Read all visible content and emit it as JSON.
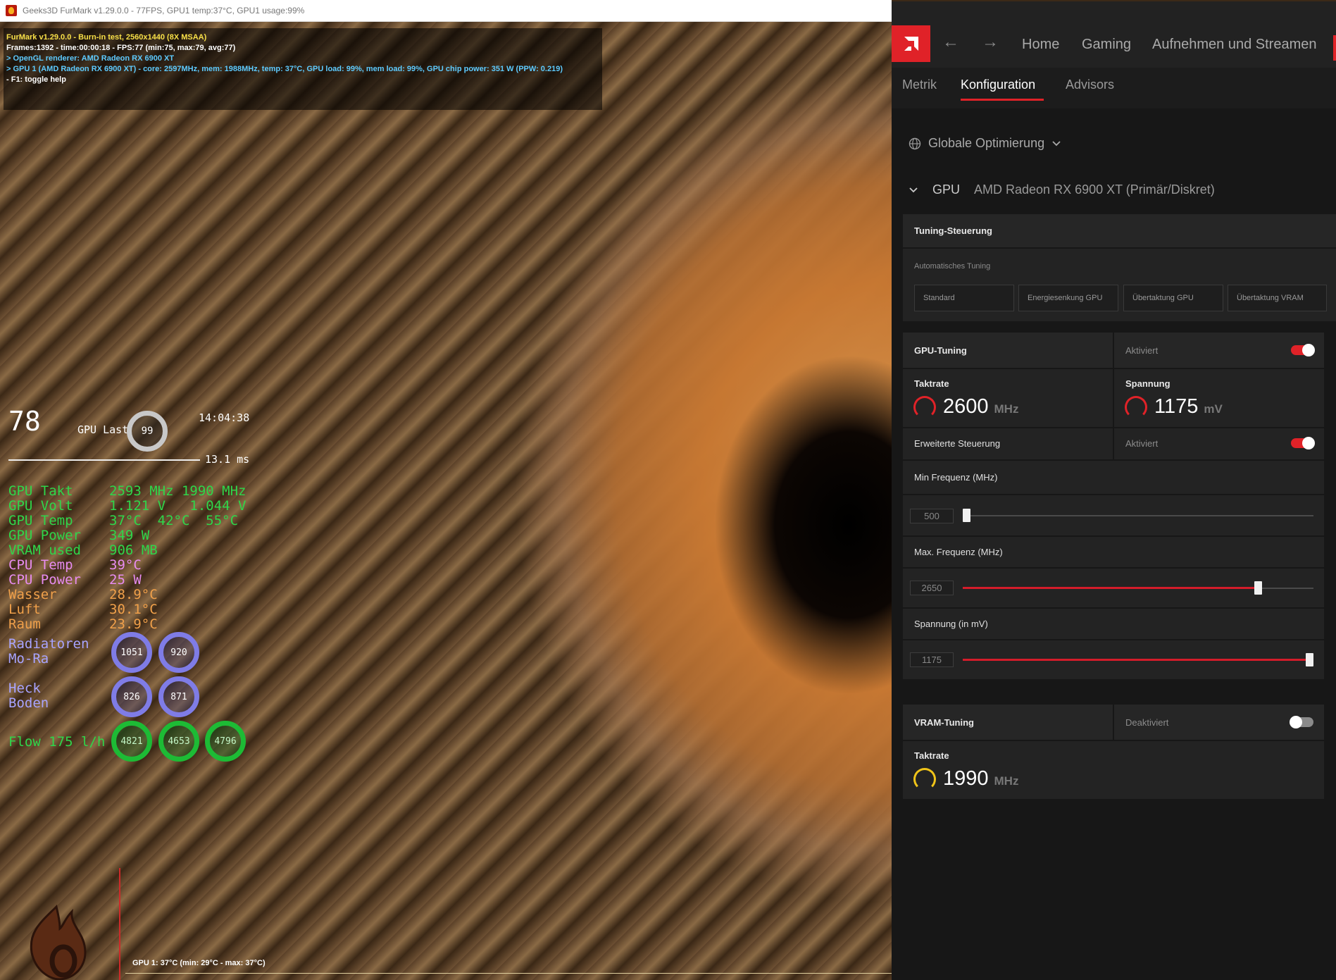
{
  "furmark": {
    "window_title": "Geeks3D FurMark v1.29.0.0 - 77FPS, GPU1 temp:37°C, GPU1 usage:99%",
    "osd": [
      "FurMark v1.29.0.0 - Burn-in test, 2560x1440 (8X MSAA)",
      "Frames:1392 - time:00:00:18 - FPS:77 (min:75, max:79, avg:77)",
      "> OpenGL renderer: AMD Radeon RX 6900 XT",
      "> GPU 1 (AMD Radeon RX 6900 XT) - core: 2597MHz, mem: 1988MHz, temp: 37°C, GPU load: 99%, mem load: 99%, GPU chip power: 351 W (PPW: 0.219)",
      "- F1: toggle help"
    ],
    "graph_label": "GPU 1: 37°C (min: 29°C - max: 37°C)"
  },
  "overlay": {
    "fps": "78",
    "gpu_last_label": "GPU Last",
    "gpu_last_value": "99",
    "clock": "14:04:38",
    "frametime": "13.1 ms",
    "stats": [
      {
        "k": "GPU Takt",
        "v": "2593 MHz 1990 MHz",
        "color": "green"
      },
      {
        "k": "GPU Volt",
        "v": "1.121 V   1.044 V",
        "color": "green"
      },
      {
        "k": "GPU Temp",
        "v": "37°C  42°C  55°C",
        "color": "green"
      },
      {
        "k": "GPU Power",
        "v": "349 W",
        "color": "green"
      },
      {
        "k": "VRAM used",
        "v": "906 MB",
        "color": "green"
      },
      {
        "k": "CPU Temp",
        "v": "39°C",
        "color": "violet"
      },
      {
        "k": "CPU Power",
        "v": "25 W",
        "color": "violet"
      },
      {
        "k": "Wasser",
        "v": "28.9°C",
        "color": "orange"
      },
      {
        "k": "Luft",
        "v": "30.1°C",
        "color": "orange"
      },
      {
        "k": "Raum",
        "v": "23.9°C",
        "color": "orange"
      }
    ],
    "radiatoren_label_1": "Radiatoren",
    "radiatoren_label_2": "Mo-Ra",
    "radiatoren_values": [
      "1051",
      "920"
    ],
    "heck_label_1": "Heck",
    "heck_label_2": "Boden",
    "heck_values": [
      "826",
      "871"
    ],
    "flow_label": "Flow 175 l/h",
    "flow_values": [
      "4821",
      "4653",
      "4796"
    ]
  },
  "amd": {
    "nav": {
      "back_icon": "arrow-left-icon",
      "forward_icon": "arrow-right-icon",
      "items": [
        "Home",
        "Gaming",
        "Aufnehmen und Streamen"
      ]
    },
    "subtabs": [
      "Metrik",
      "Konfiguration",
      "Advisors"
    ],
    "active_subtab": "Konfiguration",
    "global_optimization": "Globale Optimierung",
    "gpu_label": "GPU",
    "gpu_name": "AMD Radeon RX 6900 XT (Primär/Diskret)",
    "tuning_control": {
      "title": "Tuning-Steuerung",
      "auto_tuning_label": "Automatisches Tuning",
      "presets": [
        "Standard",
        "Energiesenkung GPU",
        "Übertaktung GPU",
        "Übertaktung VRAM"
      ]
    },
    "gpu_tuning": {
      "title": "GPU-Tuning",
      "status": "Aktiviert",
      "enabled": true,
      "clock_label": "Taktrate",
      "clock_value": "2600",
      "clock_unit": "MHz",
      "voltage_label": "Spannung",
      "voltage_value": "1175",
      "voltage_unit": "mV",
      "advanced_label": "Erweiterte Steuerung",
      "advanced_status": "Aktiviert",
      "advanced_enabled": true,
      "min_freq_label": "Min Frequenz (MHz)",
      "min_freq_value": "500",
      "min_freq_fraction": 0.0,
      "max_freq_label": "Max. Frequenz (MHz)",
      "max_freq_value": "2650",
      "max_freq_fraction": 0.85,
      "voltage_slider_label": "Spannung (in mV)",
      "voltage_slider_value": "1175",
      "voltage_slider_fraction": 1.0
    },
    "vram_tuning": {
      "title": "VRAM-Tuning",
      "status": "Deaktiviert",
      "enabled": false,
      "clock_label": "Taktrate",
      "clock_value": "1990",
      "clock_unit": "MHz"
    },
    "colors": {
      "accent_red": "#e02228",
      "ring_yellow": "#f0c419",
      "overlay_green": "#2fd64a",
      "overlay_violet": "#e78cf0",
      "overlay_orange": "#f0a04a"
    }
  }
}
